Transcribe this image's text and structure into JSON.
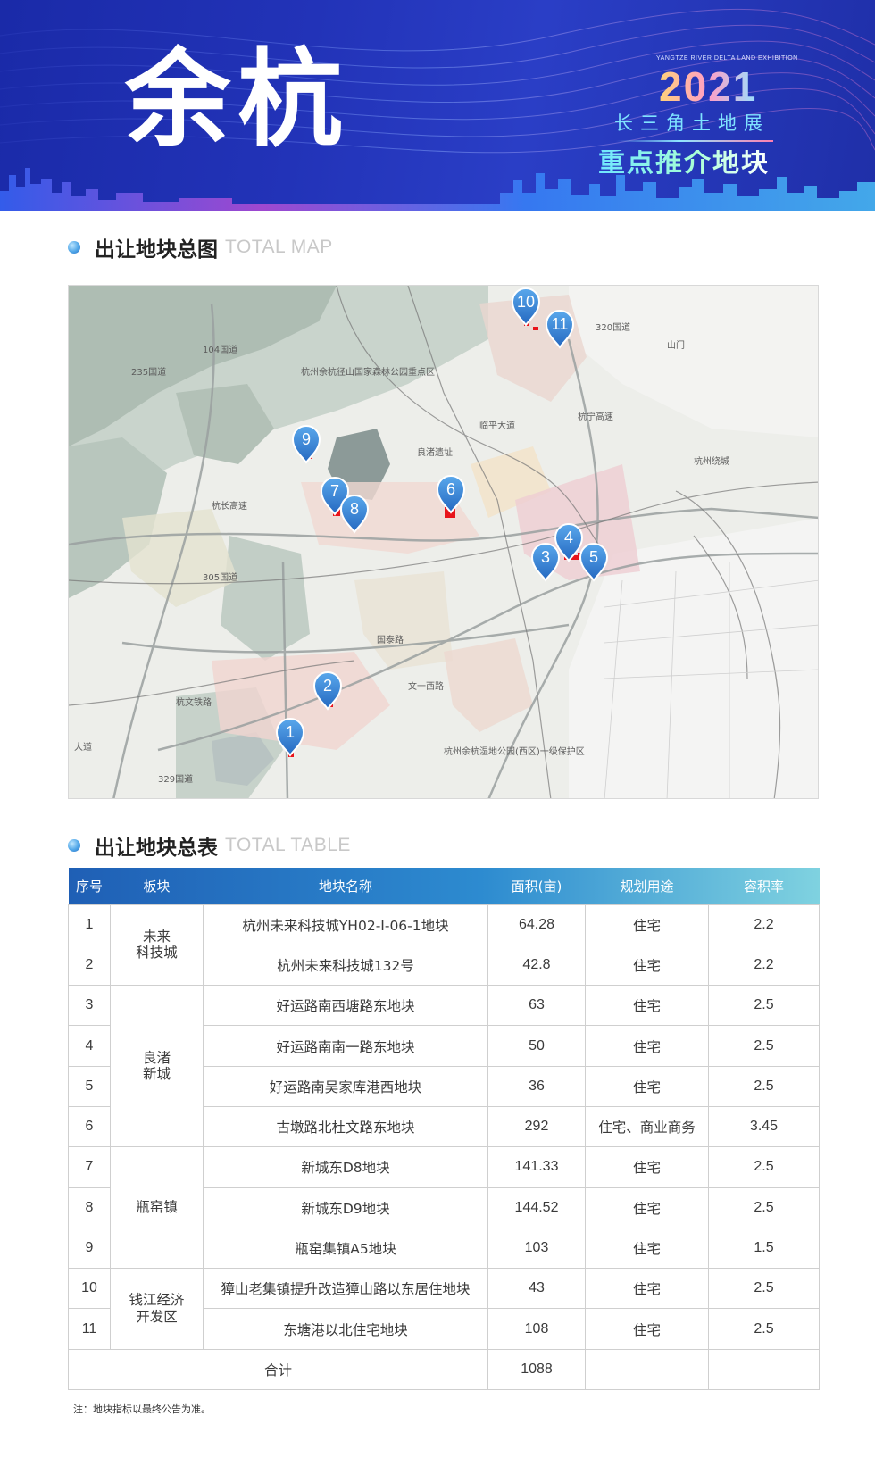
{
  "banner": {
    "title": "余杭",
    "en_line": "YANGTZE RIVER DELTA LAND EXHIBITION",
    "year": "2021",
    "subtitle": "长三角土地展",
    "tag": "重点推介地块"
  },
  "map_section": {
    "title_cn": "出让地块总图",
    "title_en": "TOTAL MAP"
  },
  "map": {
    "pins": [
      "1",
      "2",
      "3",
      "4",
      "5",
      "6",
      "7",
      "8",
      "9",
      "10",
      "11"
    ],
    "labels": {
      "wenyi_rd": "文一西路",
      "road_235": "235国道",
      "road_104": "104国道",
      "road_305": "305国道",
      "road_329": "329国道",
      "road_320": "320国道",
      "hangchang": "杭长高速",
      "hangning": "杭宁高速",
      "yuhang_rd": "临平大道",
      "hangwen": "杭文铁路",
      "dadao": "大道",
      "hanghang": "杭州绕城",
      "guotai": "国泰路",
      "wetland": "杭州余杭湿地公园(西区)一级保护区",
      "forest": "杭州余杭径山国家森林公园重点区",
      "liangzhu": "良渚遗址",
      "shanmen": "山门"
    }
  },
  "table_section": {
    "title_cn": "出让地块总表",
    "title_en": "TOTAL TABLE"
  },
  "table": {
    "headers": {
      "no": "序号",
      "zone": "板块",
      "name": "地块名称",
      "area": "面积(亩)",
      "use": "规划用途",
      "far": "容积率"
    },
    "zones": {
      "z1": "未来\n科技城",
      "z2": "良渚\n新城",
      "z3": "瓶窑镇",
      "z4": "钱江经济\n开发区"
    },
    "rows": [
      {
        "no": "1",
        "name": "杭州未来科技城YH02-I-06-1地块",
        "area": "64.28",
        "use": "住宅",
        "far": "2.2"
      },
      {
        "no": "2",
        "name": "杭州未来科技城132号",
        "area": "42.8",
        "use": "住宅",
        "far": "2.2"
      },
      {
        "no": "3",
        "name": "好运路南西塘路东地块",
        "area": "63",
        "use": "住宅",
        "far": "2.5"
      },
      {
        "no": "4",
        "name": "好运路南南一路东地块",
        "area": "50",
        "use": "住宅",
        "far": "2.5"
      },
      {
        "no": "5",
        "name": "好运路南吴家库港西地块",
        "area": "36",
        "use": "住宅",
        "far": "2.5"
      },
      {
        "no": "6",
        "name": "古墩路北杜文路东地块",
        "area": "292",
        "use": "住宅、商业商务",
        "far": "3.45"
      },
      {
        "no": "7",
        "name": "新城东D8地块",
        "area": "141.33",
        "use": "住宅",
        "far": "2.5"
      },
      {
        "no": "8",
        "name": "新城东D9地块",
        "area": "144.52",
        "use": "住宅",
        "far": "2.5"
      },
      {
        "no": "9",
        "name": "瓶窑集镇A5地块",
        "area": "103",
        "use": "住宅",
        "far": "1.5"
      },
      {
        "no": "10",
        "name": "獐山老集镇提升改造獐山路以东居住地块",
        "area": "43",
        "use": "住宅",
        "far": "2.5"
      },
      {
        "no": "11",
        "name": "东塘港以北住宅地块",
        "area": "108",
        "use": "住宅",
        "far": "2.5"
      }
    ],
    "total_label": "合计",
    "total_area": "1088"
  },
  "note": "注：地块指标以最终公告为准。",
  "colors": {
    "header_start": "#1f5fb5",
    "header_end": "#7fd2e0",
    "pin": "#2f7fd1",
    "parcel": "#e8141b"
  }
}
